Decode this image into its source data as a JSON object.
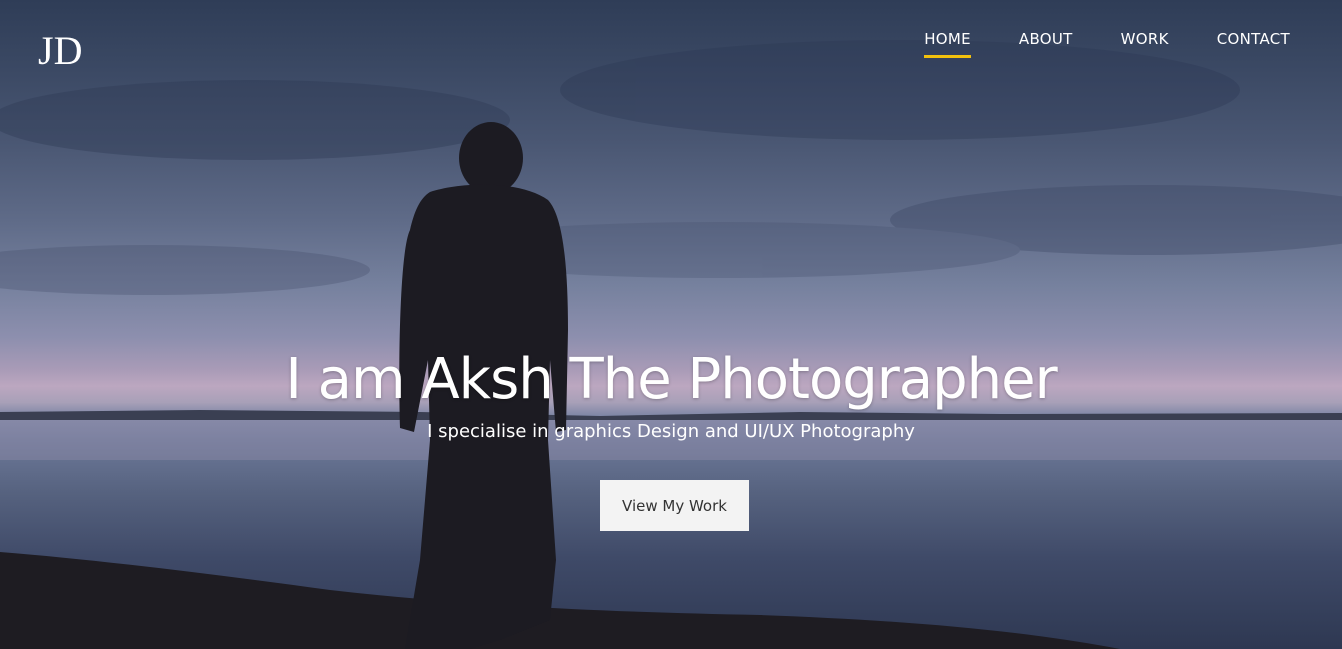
{
  "logo": {
    "text": "JD",
    "icon": "jd-monogram-logo"
  },
  "nav": {
    "items": [
      {
        "label": "HOME",
        "active": true
      },
      {
        "label": "ABOUT",
        "active": false
      },
      {
        "label": "WORK",
        "active": false
      },
      {
        "label": "CONTACT",
        "active": false
      }
    ],
    "active_underline_color": "#f2c10d"
  },
  "hero": {
    "headline": "I am Aksh The Photographer",
    "subheadline": "I specialise in graphics Design and UI/UX Photography",
    "cta_label": "View My Work",
    "background_image": "silhouette-man-by-lake-at-dusk"
  }
}
